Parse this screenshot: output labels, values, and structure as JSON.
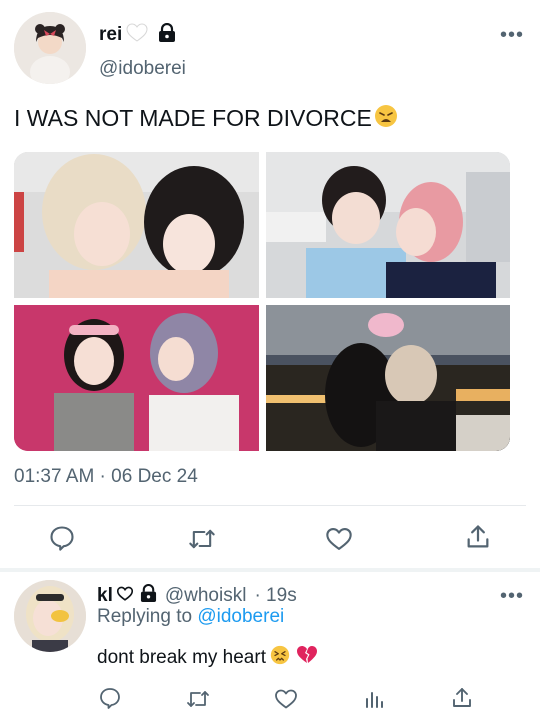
{
  "tweet": {
    "author_name": "rei",
    "author_handle": "@idoberei",
    "text": "I WAS NOT MADE FOR DIVORCE",
    "timestamp": "01:37 AM · 06 Dec 24",
    "more_label": "•••",
    "photos": [
      {
        "alt": "photo-1"
      },
      {
        "alt": "photo-2"
      },
      {
        "alt": "photo-3"
      },
      {
        "alt": "photo-4"
      }
    ],
    "actions": [
      "reply-icon",
      "retweet-icon",
      "like-icon",
      "share-icon"
    ]
  },
  "reply": {
    "author_name": "kl",
    "author_handle": "@whoiskl",
    "time": "· 19s",
    "replying_prefix": "Replying to",
    "replying_handle": "@idoberei",
    "text": "dont break my heart",
    "more_label": "•••",
    "actions": [
      "reply-icon",
      "retweet-icon",
      "like-icon",
      "analytics-icon",
      "share-icon"
    ]
  },
  "colors": {
    "accent": "#1d9bf0",
    "secondary_text": "#536471",
    "divider": "#e6e9ec"
  }
}
